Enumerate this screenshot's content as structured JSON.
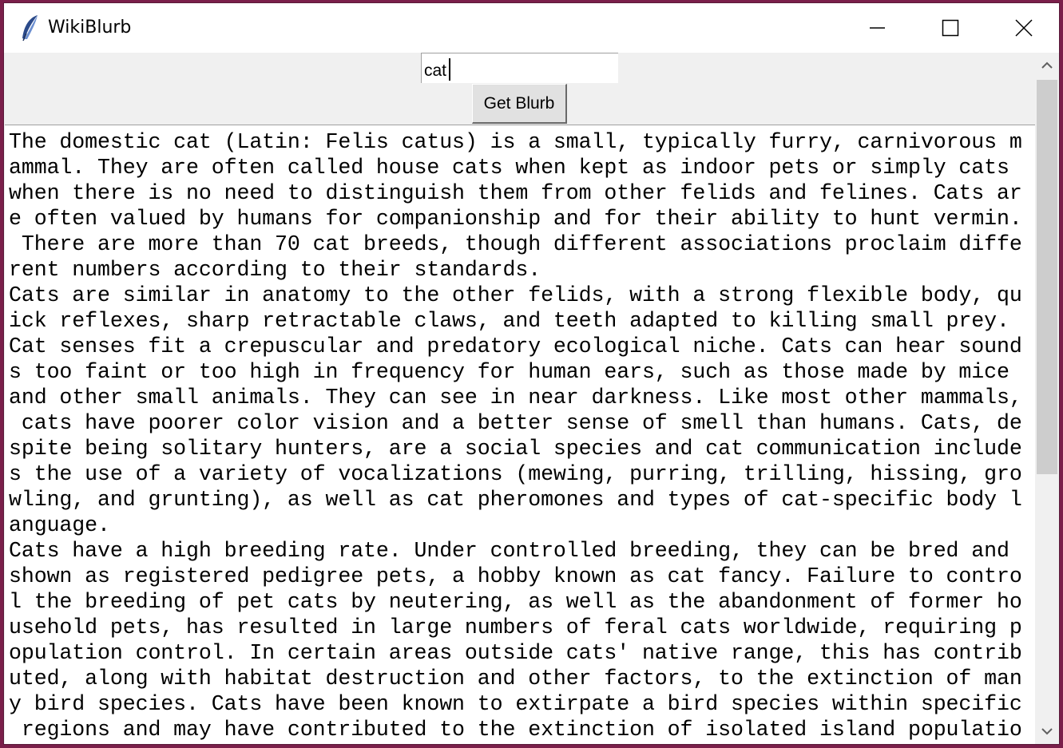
{
  "window": {
    "title": "WikiBlurb",
    "icon": "feather-icon",
    "controls": [
      "minimize-icon",
      "maximize-icon",
      "close-icon"
    ]
  },
  "search": {
    "value": "cat"
  },
  "button": {
    "label": "Get Blurb"
  },
  "blurb": {
    "lines": [
      "The domestic cat (Latin: Felis catus) is a small, typically furry, carnivorous m",
      "ammal. They are often called house cats when kept as indoor pets or simply cats ",
      "when there is no need to distinguish them from other felids and felines. Cats ar",
      "e often valued by humans for companionship and for their ability to hunt vermin.",
      " There are more than 70 cat breeds, though different associations proclaim diffe",
      "rent numbers according to their standards.",
      "Cats are similar in anatomy to the other felids, with a strong flexible body, qu",
      "ick reflexes, sharp retractable claws, and teeth adapted to killing small prey. ",
      "Cat senses fit a crepuscular and predatory ecological niche. Cats can hear sound",
      "s too faint or too high in frequency for human ears, such as those made by mice ",
      "and other small animals. They can see in near darkness. Like most other mammals,",
      " cats have poorer color vision and a better sense of smell than humans. Cats, de",
      "spite being solitary hunters, are a social species and cat communication include",
      "s the use of a variety of vocalizations (mewing, purring, trilling, hissing, gro",
      "wling, and grunting), as well as cat pheromones and types of cat-specific body l",
      "anguage.",
      "Cats have a high breeding rate. Under controlled breeding, they can be bred and ",
      "shown as registered pedigree pets, a hobby known as cat fancy. Failure to contro",
      "l the breeding of pet cats by neutering, as well as the abandonment of former ho",
      "usehold pets, has resulted in large numbers of feral cats worldwide, requiring p",
      "opulation control. In certain areas outside cats' native range, this has contrib",
      "uted, along with habitat destruction and other factors, to the extinction of man",
      "y bird species. Cats have been known to extirpate a bird species within specific",
      " regions and may have contributed to the extinction of isolated island populatio"
    ]
  },
  "scrollbar": {
    "icons": [
      "chevron-up-icon",
      "chevron-down-icon"
    ]
  }
}
